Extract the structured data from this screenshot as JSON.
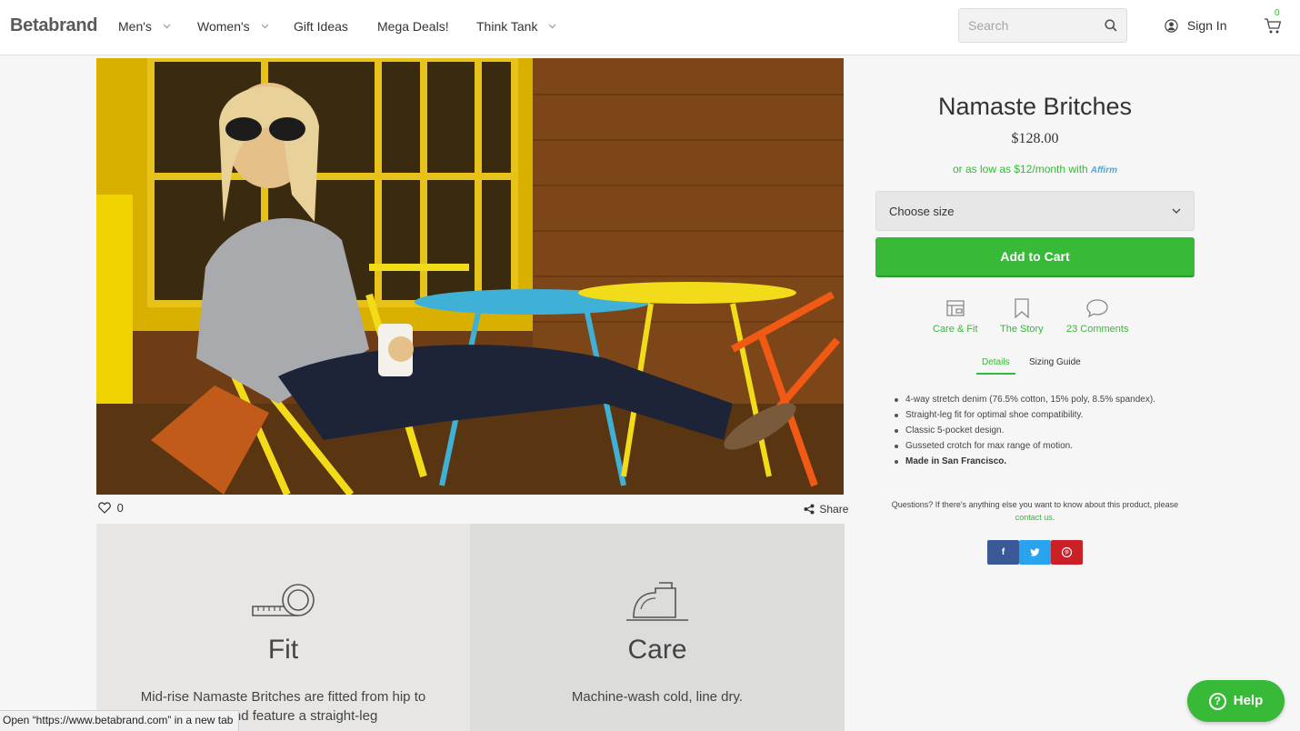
{
  "brand": {
    "logo_text": "Betabrand",
    "accent_color": "#38b938"
  },
  "nav": {
    "items": [
      {
        "label": "Men's",
        "has_dropdown": true
      },
      {
        "label": "Women's",
        "has_dropdown": true
      },
      {
        "label": "Gift Ideas",
        "has_dropdown": false
      },
      {
        "label": "Mega Deals!",
        "has_dropdown": false
      },
      {
        "label": "Think Tank",
        "has_dropdown": true
      }
    ]
  },
  "search": {
    "placeholder": "Search",
    "icon": "search-icon"
  },
  "account": {
    "signin_label": "Sign In",
    "icon": "user-icon"
  },
  "cart": {
    "count": "0",
    "icon": "cart-icon"
  },
  "hero": {
    "likes": "0",
    "like_icon": "heart-icon",
    "share_label": "Share",
    "share_icon": "share-icon"
  },
  "info_cards": [
    {
      "icon": "tape-measure-icon",
      "title": "Fit",
      "text": "Mid-rise Namaste Britches are fitted from hip to knee, and feature a straight-leg"
    },
    {
      "icon": "iron-icon",
      "title": "Care",
      "text": "Machine-wash cold, line dry."
    }
  ],
  "product": {
    "title": "Namaste Britches",
    "price": "$128.00",
    "financing_text": "or as low as $12/month with",
    "financing_brand": "Affirm",
    "size_select": "Choose size",
    "add_to_cart": "Add to Cart"
  },
  "actions": [
    {
      "label": "Care & Fit",
      "icon": "sewing-machine-icon"
    },
    {
      "label": "The Story",
      "icon": "bookmark-icon"
    },
    {
      "label": "23 Comments",
      "icon": "comment-icon"
    }
  ],
  "detail_tabs": [
    {
      "label": "Details",
      "active": true
    },
    {
      "label": "Sizing Guide",
      "active": false
    }
  ],
  "features": [
    "4-way stretch denim (76.5% cotton, 15% poly, 8.5% spandex).",
    "Straight-leg fit for optimal shoe compatibility.",
    "Classic 5-pocket design.",
    "Gusseted crotch for max range of motion.",
    "Made in San Francisco."
  ],
  "questions": {
    "text": "Questions? If there's anything else you want to know about this product, please",
    "link": "contact us."
  },
  "social": [
    {
      "name": "facebook",
      "glyph": "f",
      "color": "#3b5998"
    },
    {
      "name": "twitter",
      "glyph": "t",
      "color": "#2aa3ef"
    },
    {
      "name": "pinterest",
      "glyph": "p",
      "color": "#cb2027"
    }
  ],
  "status_bar": "Open “https://www.betabrand.com” in a new tab",
  "help": {
    "label": "Help",
    "glyph": "?"
  }
}
